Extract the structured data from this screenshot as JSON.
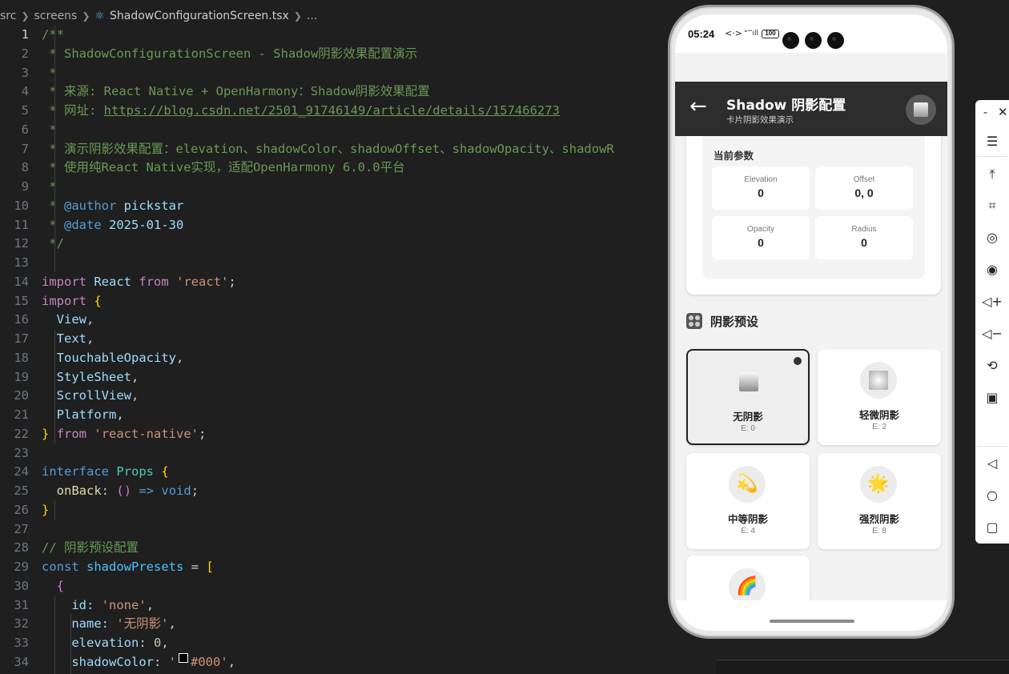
{
  "editor": {
    "breadcrumb": {
      "part1": "src",
      "part2": "screens",
      "file": "ShadowConfigurationScreen.tsx",
      "more": "..."
    },
    "lines": [
      {
        "n": "1"
      },
      {
        "n": "2"
      },
      {
        "n": "3"
      },
      {
        "n": "4"
      },
      {
        "n": "5"
      },
      {
        "n": "6"
      },
      {
        "n": "7"
      },
      {
        "n": "8"
      },
      {
        "n": "9"
      },
      {
        "n": "10"
      },
      {
        "n": "11"
      },
      {
        "n": "12"
      },
      {
        "n": "13"
      },
      {
        "n": "14"
      },
      {
        "n": "15"
      },
      {
        "n": "16"
      },
      {
        "n": "17"
      },
      {
        "n": "18"
      },
      {
        "n": "19"
      },
      {
        "n": "20"
      },
      {
        "n": "21"
      },
      {
        "n": "22"
      },
      {
        "n": "23"
      },
      {
        "n": "24"
      },
      {
        "n": "25"
      },
      {
        "n": "26"
      },
      {
        "n": "27"
      },
      {
        "n": "28"
      },
      {
        "n": "29"
      },
      {
        "n": "30"
      },
      {
        "n": "31"
      },
      {
        "n": "32"
      },
      {
        "n": "33"
      },
      {
        "n": "34"
      }
    ],
    "code": {
      "l1": "/**",
      "l2": " * ShadowConfigurationScreen - Shadow阴影效果配置演示",
      "l3": " *",
      "l4": " * 来源: React Native + OpenHarmony：Shadow阴影效果配置",
      "l5a": " * 网址: ",
      "l5b": "https://blog.csdn.net/2501_91746149/article/details/157466273",
      "l6": " *",
      "l7": " * 演示阴影效果配置：elevation、shadowColor、shadowOffset、shadowOpacity、shadowR",
      "l8": " * 使用纯React Native实现，适配OpenHarmony 6.0.0平台",
      "l9": " *",
      "l10a": " * ",
      "l10b": "@author",
      "l10c": " pickstar",
      "l11a": " * ",
      "l11b": "@date",
      "l11c": " 2025-01-30",
      "l12": " */",
      "import": "import",
      "from": "from",
      "react": "React",
      "react_str": "'react'",
      "semi": ";",
      "brace_open": "{",
      "brace_close": "}",
      "comma": ",",
      "view": "View",
      "text": "Text",
      "touchable": "TouchableOpacity",
      "stylesheet": "StyleSheet",
      "scrollview": "ScrollView",
      "platform": "Platform",
      "rn_str": "'react-native'",
      "interface": "interface",
      "props": "Props",
      "onback": "onBack",
      "colon": ":",
      "arrow_params": "()",
      "arrow": "=>",
      "void": "void",
      "comment28": "// 阴影预设配置",
      "const": "const",
      "presets_var": "shadowPresets",
      "eq": "=",
      "bracket": "[",
      "id_key": "id",
      "id_val": "'none'",
      "name_key": "name",
      "name_val": "'无阴影'",
      "elev_key": "elevation",
      "elev_val": "0",
      "color_key": "shadowColor",
      "color_q": "'",
      "color_val": "#000'"
    }
  },
  "phone": {
    "status": {
      "time": "05:24",
      "net": "<·>",
      "signal": "°⁗ıll",
      "battery": "100"
    },
    "header": {
      "title": "Shadow 阴影配置",
      "subtitle": "卡片阴影效果演示"
    },
    "params": {
      "title": "当前参数",
      "items": [
        {
          "label": "Elevation",
          "value": "0"
        },
        {
          "label": "Offset",
          "value": "0, 0"
        },
        {
          "label": "Opacity",
          "value": "0"
        },
        {
          "label": "Radius",
          "value": "0"
        }
      ]
    },
    "presets": {
      "title": "阴影预设",
      "items": [
        {
          "name": "无阴影",
          "elevation": "E: 0",
          "icon": "gradient-square-icon",
          "selected": true
        },
        {
          "name": "轻微阴影",
          "elevation": "E: 2",
          "icon": "soft-square-icon",
          "selected": false
        },
        {
          "name": "中等阴影",
          "elevation": "E: 4",
          "icon": "dizzy-icon",
          "glyph": "💫",
          "selected": false
        },
        {
          "name": "强烈阴影",
          "elevation": "E: 8",
          "icon": "sun-icon",
          "glyph": "🌟",
          "selected": false
        },
        {
          "name": "",
          "elevation": "",
          "icon": "rainbow-icon",
          "glyph": "🌈",
          "selected": false
        }
      ]
    }
  },
  "toolbar": {
    "min": "-",
    "close": "✕",
    "items": [
      "menu-icon",
      "pin-top-icon",
      "crop-icon",
      "screenshot-icon",
      "record-icon",
      "volume-up-icon",
      "volume-down-icon",
      "rotate-icon",
      "fold-icon",
      "back-nav-icon",
      "home-nav-icon",
      "recent-nav-icon"
    ]
  }
}
